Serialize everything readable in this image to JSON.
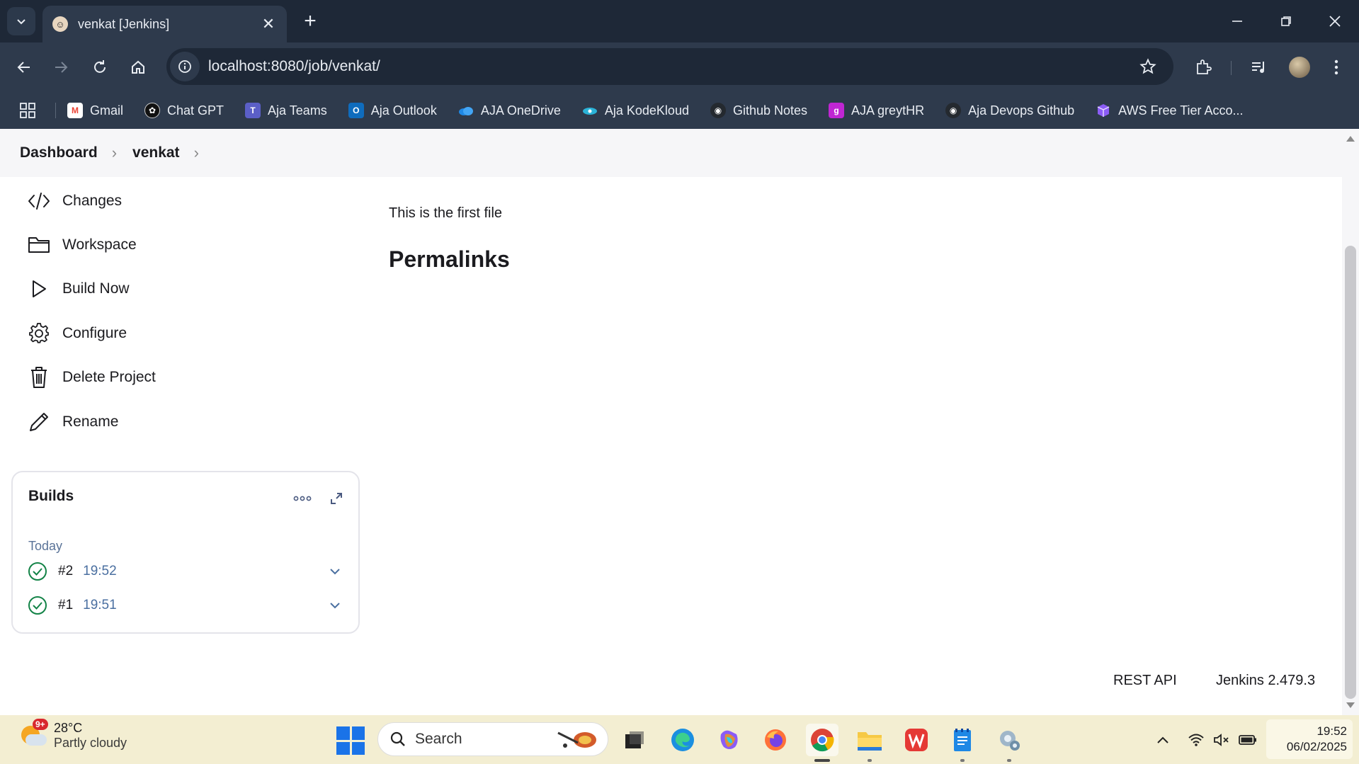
{
  "browser": {
    "tab_title": "venkat [Jenkins]",
    "url": "localhost:8080/job/venkat/",
    "bookmarks": [
      {
        "label": "Gmail",
        "icon": "gmail-icon",
        "color": "#ea4335"
      },
      {
        "label": "Chat GPT",
        "icon": "chatgpt-icon",
        "color": "#111111"
      },
      {
        "label": "Aja Teams",
        "icon": "teams-icon",
        "color": "#5b5fc7"
      },
      {
        "label": "Aja Outlook",
        "icon": "outlook-icon",
        "color": "#0f6cbd"
      },
      {
        "label": "AJA OneDrive",
        "icon": "onedrive-icon",
        "color": "#1e88e5"
      },
      {
        "label": "Aja KodeKloud",
        "icon": "kodekloud-icon",
        "color": "#2bb3d8"
      },
      {
        "label": "Github Notes",
        "icon": "github-icon",
        "color": "#24292f"
      },
      {
        "label": "AJA greytHR",
        "icon": "greythr-icon",
        "color": "#c026d3"
      },
      {
        "label": "Aja Devops Github",
        "icon": "github-icon",
        "color": "#24292f"
      },
      {
        "label": "AWS Free Tier Acco...",
        "icon": "aws-cube-icon",
        "color": "#8b5cf6"
      }
    ]
  },
  "breadcrumb": {
    "items": [
      "Dashboard",
      "venkat"
    ]
  },
  "sidebar": {
    "tasks": [
      {
        "label": "Changes",
        "icon": "code-icon"
      },
      {
        "label": "Workspace",
        "icon": "folder-icon"
      },
      {
        "label": "Build Now",
        "icon": "play-icon"
      },
      {
        "label": "Configure",
        "icon": "gear-icon"
      },
      {
        "label": "Delete Project",
        "icon": "trash-icon"
      },
      {
        "label": "Rename",
        "icon": "pencil-icon"
      }
    ]
  },
  "builds": {
    "title": "Builds",
    "day": "Today",
    "items": [
      {
        "number": "#2",
        "time": "19:52",
        "status": "success"
      },
      {
        "number": "#1",
        "time": "19:51",
        "status": "success"
      }
    ]
  },
  "main": {
    "description": "This is the first file",
    "permalinks_heading": "Permalinks"
  },
  "footer": {
    "rest_api": "REST API",
    "version": "Jenkins 2.479.3"
  },
  "taskbar": {
    "weather_temp": "28°C",
    "weather_desc": "Partly cloudy",
    "weather_badge": "9+",
    "search_placeholder": "Search",
    "time": "19:52",
    "date": "06/02/2025"
  },
  "colors": {
    "success": "#138347",
    "link_blue": "#4a6fa0",
    "chrome_dark": "#1e2837"
  }
}
